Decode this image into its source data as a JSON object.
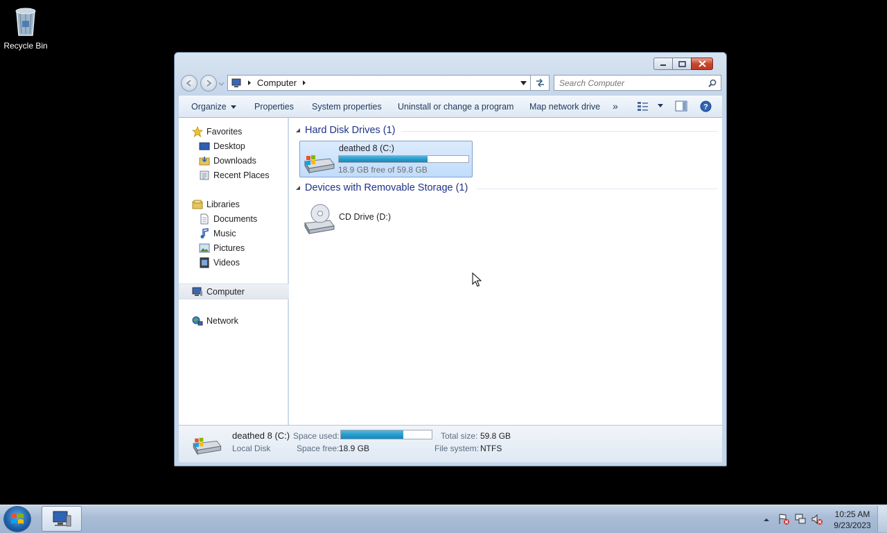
{
  "desktop": {
    "recycle_bin_label": "Recycle Bin"
  },
  "window": {
    "address": {
      "crumbs": [
        "Computer"
      ]
    },
    "search": {
      "placeholder": "Search Computer"
    },
    "commands": {
      "organize": "Organize",
      "properties": "Properties",
      "system_properties": "System properties",
      "uninstall": "Uninstall or change a program",
      "map_drive": "Map network drive",
      "more": "»"
    },
    "nav": {
      "favorites": "Favorites",
      "desktop": "Desktop",
      "downloads": "Downloads",
      "recent_places": "Recent Places",
      "libraries": "Libraries",
      "documents": "Documents",
      "music": "Music",
      "pictures": "Pictures",
      "videos": "Videos",
      "computer": "Computer",
      "network": "Network"
    },
    "groups": {
      "hard_disk": "Hard Disk Drives (1)",
      "removable": "Devices with Removable Storage (1)"
    },
    "drive_c": {
      "name": "deathed 8 (C:)",
      "free_text": "18.9 GB free of 59.8 GB",
      "used_fraction": 0.684
    },
    "drive_d": {
      "name": "CD Drive (D:)"
    },
    "details": {
      "name": "deathed 8 (C:)",
      "type": "Local Disk",
      "space_used_label": "Space used:",
      "space_free_label": "Space free:",
      "space_free_value": "18.9 GB",
      "total_size_label": "Total size:",
      "total_size_value": "59.8 GB",
      "file_system_label": "File system:",
      "file_system_value": "NTFS",
      "used_fraction": 0.684
    }
  },
  "taskbar": {
    "time": "10:25 AM",
    "date": "9/23/2023"
  },
  "colors": {
    "accent": "#1e3287",
    "progress": "#27a0d0",
    "close": "#c8462f"
  }
}
